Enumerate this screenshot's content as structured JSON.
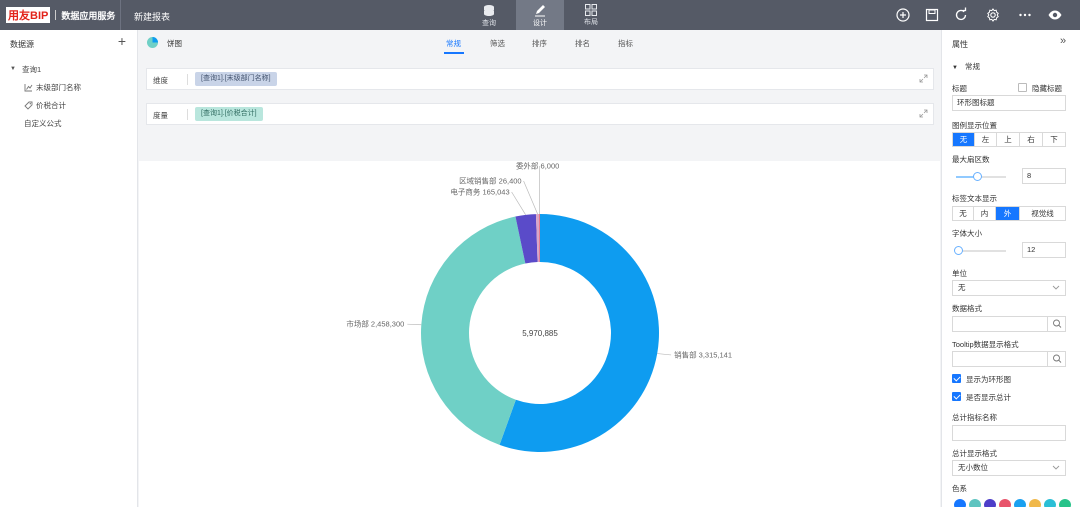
{
  "topbar": {
    "brand_logo": "用友BIP",
    "brand_name": "数据应用服务",
    "report_title": "新建报表",
    "modes": [
      {
        "label": "查询",
        "icon": "database-icon",
        "active": false
      },
      {
        "label": "设计",
        "icon": "pen-icon",
        "active": true
      },
      {
        "label": "布局",
        "icon": "grid-icon",
        "active": false
      }
    ],
    "tools": [
      "add-circle-icon",
      "save-icon",
      "refresh-icon",
      "settings-icon",
      "more-icon",
      "preview-eye-icon"
    ]
  },
  "left_panel": {
    "title": "数据源",
    "add_label": "+",
    "tree": [
      {
        "label": "查询1",
        "icon": "caret-down-icon",
        "level": 0
      },
      {
        "label": "末级部门名称",
        "icon": "dimension-icon",
        "level": 1
      },
      {
        "label": "价税合计",
        "icon": "measure-tag-icon",
        "level": 1
      },
      {
        "label": "自定义公式",
        "icon": "",
        "level": 0
      }
    ]
  },
  "center": {
    "chart_type_label": "饼图",
    "tabs": [
      {
        "label": "常规",
        "active": true
      },
      {
        "label": "筛选",
        "active": false
      },
      {
        "label": "排序",
        "active": false
      },
      {
        "label": "排名",
        "active": false
      },
      {
        "label": "指标",
        "active": false
      }
    ],
    "dimension": {
      "label": "维度",
      "chip": "[查询1].[末级部门名称]"
    },
    "measure": {
      "label": "度量",
      "chip": "[查询1].[价税合计]"
    }
  },
  "chart_data": {
    "type": "pie",
    "donut": true,
    "center_label": "5,970,885",
    "categories": [
      "销售部",
      "市场部",
      "电子商务",
      "区域销售部",
      "委外部"
    ],
    "values": [
      3315141,
      2458300,
      165043,
      26400,
      6000
    ],
    "value_labels": [
      "3,315,141",
      "2,458,300",
      "165,043",
      "26,400",
      "6,000"
    ],
    "colors": [
      "#0e9cf0",
      "#6fd0c6",
      "#5a4bc9",
      "#d9a6c7",
      "#e8546b"
    ]
  },
  "right_panel": {
    "title": "属性",
    "collapse_icon": "double-chevron-right-icon",
    "section": "常规",
    "title_label": "标题",
    "hide_title_label": "隐藏标题",
    "hide_title_checked": false,
    "title_value": "环形图标题",
    "legend_position_label": "图例显示位置",
    "legend_positions": [
      {
        "label": "无",
        "active": true
      },
      {
        "label": "左",
        "active": false
      },
      {
        "label": "上",
        "active": false
      },
      {
        "label": "右",
        "active": false
      },
      {
        "label": "下",
        "active": false
      }
    ],
    "max_sectors_label": "最大扇区数",
    "max_sectors_value": "8",
    "max_sectors_slider": 0.42,
    "label_display_label": "标签文本显示",
    "label_display_options": [
      {
        "label": "无",
        "active": false
      },
      {
        "label": "内",
        "active": false
      },
      {
        "label": "外",
        "active": true
      },
      {
        "label": "视觉线",
        "active": false
      }
    ],
    "font_size_label": "字体大小",
    "font_size_value": "12",
    "font_size_slider": 0.05,
    "unit_label": "单位",
    "unit_value": "无",
    "data_format_label": "数据格式",
    "tooltip_format_label": "Tooltip数据显示格式",
    "show_ring_label": "显示为环形图",
    "show_ring_checked": true,
    "show_total_label": "是否显示总计",
    "show_total_checked": true,
    "total_name_label": "总计指标名称",
    "total_format_label": "总计显示格式",
    "total_format_value": "无小数位",
    "palette_label": "色系",
    "palette": [
      "#1677ff",
      "#5ec4c0",
      "#4d3ec9",
      "#e8546b",
      "#1aa0f0",
      "#f0b84a",
      "#2bbfd6",
      "#28c38a"
    ]
  }
}
